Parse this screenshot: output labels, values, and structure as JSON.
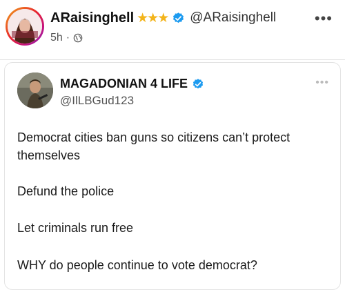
{
  "post": {
    "author_name": "ARaisinghell",
    "author_stars": "★★★",
    "author_handle": "@ARaisinghell",
    "time": "5h",
    "more": "•••"
  },
  "quoted": {
    "author_name": "MAGADONIAN 4 LIFE",
    "author_handle": "@IlLBGud123",
    "more": "•••",
    "paragraphs": [
      "Democrat cities ban guns so citizens can’t protect themselves",
      "Defund the police",
      "Let criminals run free",
      "WHY do people continue to vote democrat?"
    ]
  },
  "colors": {
    "verified": "#1d9bf0",
    "stars": "#f3b41b"
  },
  "icons": {
    "globe": "globe-icon",
    "verified": "verified-badge-icon",
    "more": "more-icon"
  }
}
